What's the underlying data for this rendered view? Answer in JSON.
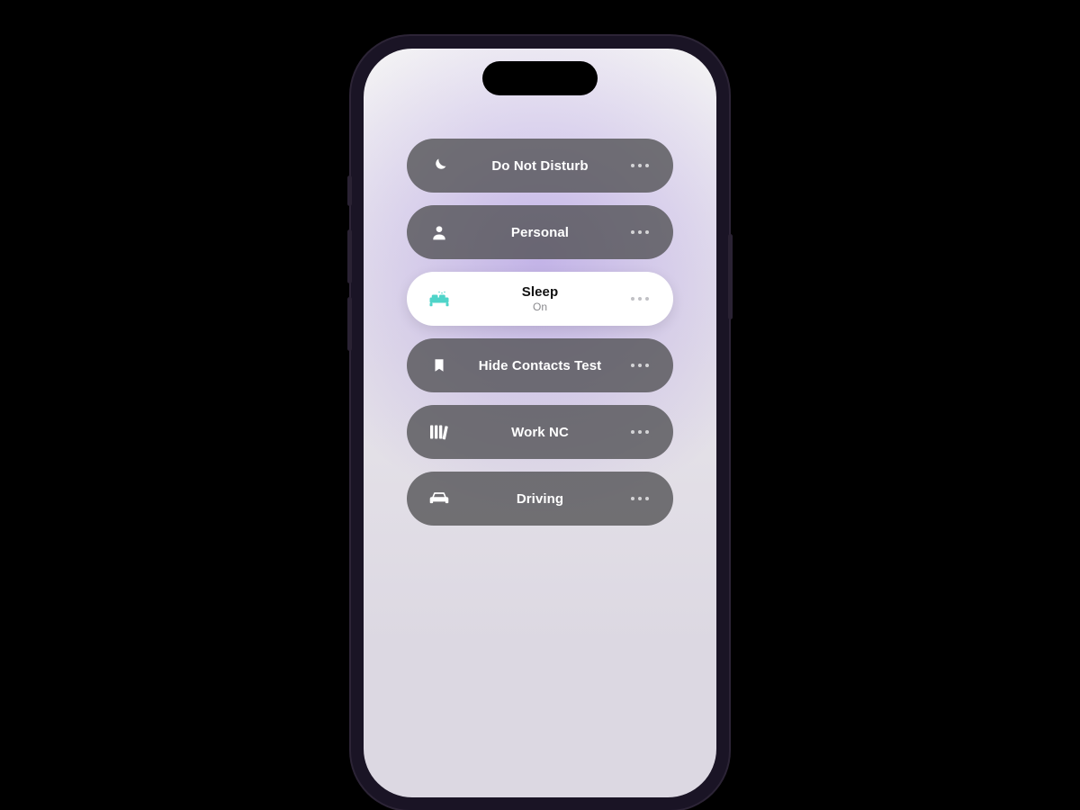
{
  "focus_modes": {
    "items": [
      {
        "id": "dnd",
        "label": "Do Not Disturb",
        "status": "",
        "icon": "moon",
        "active": false
      },
      {
        "id": "personal",
        "label": "Personal",
        "status": "",
        "icon": "person",
        "active": false
      },
      {
        "id": "sleep",
        "label": "Sleep",
        "status": "On",
        "icon": "bed",
        "active": true
      },
      {
        "id": "hide",
        "label": "Hide Contacts Test",
        "status": "",
        "icon": "bookmark",
        "active": false
      },
      {
        "id": "worknc",
        "label": "Work NC",
        "status": "",
        "icon": "books",
        "active": false
      },
      {
        "id": "driving",
        "label": "Driving",
        "status": "",
        "icon": "car",
        "active": false
      }
    ]
  },
  "colors": {
    "sleep_accent": "#4fd4c9"
  }
}
